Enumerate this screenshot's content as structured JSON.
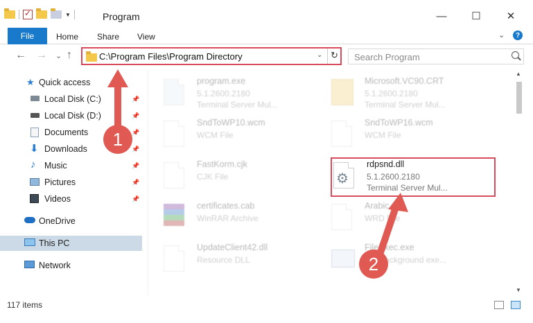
{
  "window": {
    "title": "Program",
    "minimize_glyph": "—",
    "maximize_glyph": "☐",
    "close_glyph": "✕"
  },
  "ribbon": {
    "file_tab": "File",
    "tabs": [
      "Home",
      "Share",
      "View"
    ],
    "help_glyph": "?"
  },
  "nav": {
    "back_glyph": "←",
    "forward_glyph": "→",
    "recent_glyph": "⌄",
    "up_glyph": "↑",
    "address": "C:\\Program Files\\Program Directory",
    "address_dropdown_glyph": "⌄",
    "refresh_glyph": "↻",
    "search_placeholder": "Search Program"
  },
  "sidebar": {
    "items": [
      {
        "label": "Quick access",
        "icon": "star-icon",
        "pinned": false
      },
      {
        "label": "Local Disk (C:)",
        "icon": "drive-icon",
        "pinned": true
      },
      {
        "label": "Local Disk (D:)",
        "icon": "drive-icon",
        "pinned": true
      },
      {
        "label": "Documents",
        "icon": "documents-icon",
        "pinned": true
      },
      {
        "label": "Downloads",
        "icon": "downloads-icon",
        "pinned": true
      },
      {
        "label": "Music",
        "icon": "music-icon",
        "pinned": true
      },
      {
        "label": "Pictures",
        "icon": "pictures-icon",
        "pinned": true
      },
      {
        "label": "Videos",
        "icon": "videos-icon",
        "pinned": true
      },
      {
        "label": "OneDrive",
        "icon": "cloud-icon",
        "pinned": false
      },
      {
        "label": "This PC",
        "icon": "computer-icon",
        "pinned": false,
        "selected": true
      },
      {
        "label": "Network",
        "icon": "network-icon",
        "pinned": false
      }
    ]
  },
  "files": [
    {
      "name": "program.exe",
      "line2": "5.1.2600.2180",
      "line3": "Terminal Server Mul...",
      "icon": "exe-icon",
      "dim": true
    },
    {
      "name": "Microsoft.VC90.CRT",
      "line2": "5.1.2600.2180",
      "line3": "Terminal Server Mul...",
      "icon": "folder-icon",
      "dim": true
    },
    {
      "name": "SndToWP10.wcm",
      "line2": "WCM File",
      "line3": "",
      "icon": "file-icon",
      "dim": true
    },
    {
      "name": "SndToWP16.wcm",
      "line2": "WCM File",
      "line3": "",
      "icon": "file-icon",
      "dim": true
    },
    {
      "name": "FastKorm.cjk",
      "line2": "CJK File",
      "line3": "",
      "icon": "file-icon",
      "dim": true
    },
    {
      "name": "rdpsnd.dll",
      "line2": "5.1.2600.2180",
      "line3": "Terminal Server Mul...",
      "icon": "dll-gear-icon",
      "dim": false
    },
    {
      "name": "certificates.cab",
      "line2": "WinRAR Archive",
      "line3": "",
      "icon": "archive-icon",
      "dim": true
    },
    {
      "name": "Arabic.cld",
      "line2": "WRD File",
      "line3": "",
      "icon": "file-icon",
      "dim": true
    },
    {
      "name": "UpdateClient42.dll",
      "line2": "Resource DLL",
      "line3": "",
      "icon": "dll-icon",
      "dim": true
    },
    {
      "name": "FileExec.exe",
      "line2": "File background exe...",
      "line3": "",
      "icon": "exe-icon",
      "dim": true
    }
  ],
  "status": {
    "item_count": "117 items"
  },
  "callouts": {
    "step1": "1",
    "step2": "2",
    "color": "#e05a53"
  }
}
